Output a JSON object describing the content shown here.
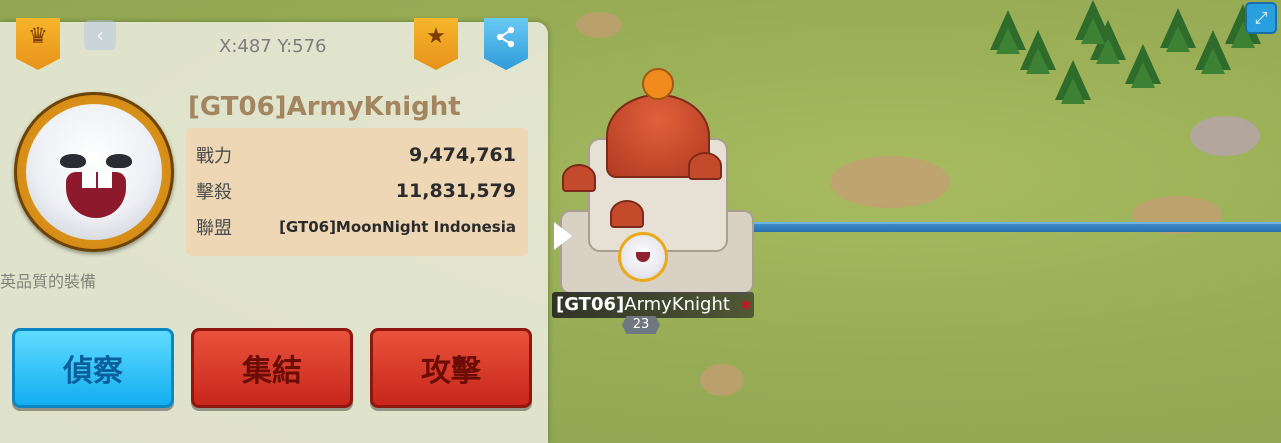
{
  "panel": {
    "coordinates": "X:487 Y:576",
    "player_name": "[GT06]ArmyKnight",
    "stats": [
      {
        "label": "戰力",
        "value": "9,474,761"
      },
      {
        "label": "擊殺",
        "value": "11,831,579"
      },
      {
        "label": "聯盟",
        "value": "[GT06]MoonNight Indonesia"
      }
    ],
    "background_text": "英品質的裝備",
    "buttons": {
      "scout": "偵察",
      "rally": "集結",
      "attack": "攻擊"
    }
  },
  "map": {
    "city_name_tag": "[GT06]",
    "city_name_rest": "ArmyKnight",
    "city_level": "23"
  },
  "icons": {
    "rank": "crown-icon",
    "favorite": "star-icon",
    "share": "share-icon",
    "expand": "expand-icon"
  }
}
